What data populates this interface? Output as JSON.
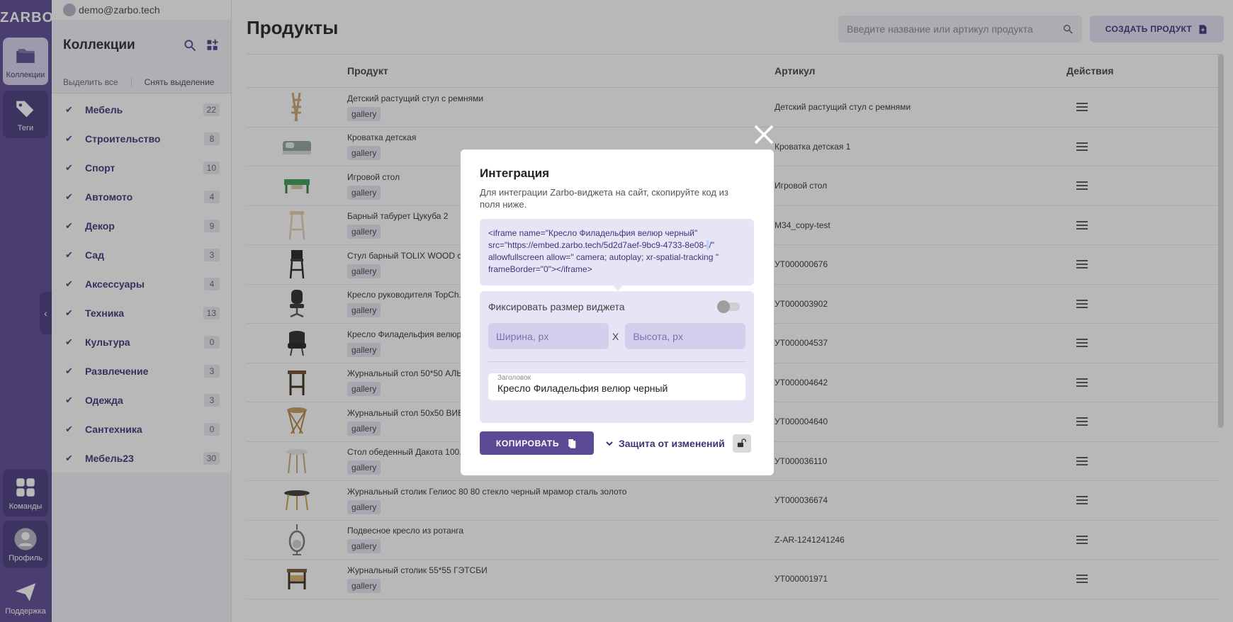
{
  "app": {
    "logo": "ZARBO",
    "user_email": "demo@zarbo.tech"
  },
  "rail": {
    "items": [
      {
        "label": "Коллекции",
        "icon": "folder-icon"
      },
      {
        "label": "Теги",
        "icon": "tags-icon"
      },
      {
        "label": "Команды",
        "icon": "grid-icon"
      },
      {
        "label": "Профиль",
        "icon": "user-icon"
      },
      {
        "label": "Поддержка",
        "icon": "send-icon"
      }
    ]
  },
  "collections": {
    "title": "Коллекции",
    "select_all": "Выделить все",
    "deselect_all": "Снять выделение",
    "items": [
      {
        "name": "Мебель",
        "count": "22"
      },
      {
        "name": "Строительство",
        "count": "8"
      },
      {
        "name": "Спорт",
        "count": "10"
      },
      {
        "name": "Автомото",
        "count": "4"
      },
      {
        "name": "Декор",
        "count": "9"
      },
      {
        "name": "Сад",
        "count": "3"
      },
      {
        "name": "Аксессуары",
        "count": "4"
      },
      {
        "name": "Техника",
        "count": "13"
      },
      {
        "name": "Культура",
        "count": "0"
      },
      {
        "name": "Развлечение",
        "count": "3"
      },
      {
        "name": "Одежда",
        "count": "3"
      },
      {
        "name": "Сантехника",
        "count": "0"
      },
      {
        "name": "Мебель23",
        "count": "30"
      }
    ]
  },
  "products": {
    "title": "Продукты",
    "search_placeholder": "Введите название или артикул продукта",
    "create_label": "СОЗДАТЬ ПРОДУКТ",
    "columns": {
      "product": "Продукт",
      "article": "Артикул",
      "actions": "Действия"
    },
    "rows": [
      {
        "name": "Детский растущий стул с ремнями",
        "tag": "gallery",
        "article": "Детский растущий стул с ремнями"
      },
      {
        "name": "Кроватка детская",
        "tag": "gallery",
        "article": "Кроватка детская 1"
      },
      {
        "name": "Игровой стол",
        "tag": "gallery",
        "article": "Игровой стол"
      },
      {
        "name": "Барный табурет Цукуба 2",
        "tag": "gallery",
        "article": "M34_copy-test"
      },
      {
        "name": "Стул барный TOLIX WOOD со...",
        "tag": "gallery",
        "article": "УТ000000676"
      },
      {
        "name": "Кресло руководителя TopCh...",
        "tag": "gallery",
        "article": "УТ000003902"
      },
      {
        "name": "Кресло Филадельфия велюр...",
        "tag": "gallery",
        "article": "УТ000004537"
      },
      {
        "name": "Журнальный стол 50*50 АЛЬ...",
        "tag": "gallery",
        "article": "УТ000004642"
      },
      {
        "name": "Журнальный стол 50x50 ВИВ...",
        "tag": "gallery",
        "article": "УТ000004640"
      },
      {
        "name": "Стол обеденный Дакота 100...",
        "tag": "gallery",
        "article": "УТ000036110"
      },
      {
        "name": "Журнальный столик Гелиос 80 80 стекло черный мрамор сталь золото",
        "tag": "gallery",
        "article": "УТ000036674"
      },
      {
        "name": "Подвесное кресло из ротанга",
        "tag": "gallery",
        "article": "Z-AR-1241241246"
      },
      {
        "name": "Журнальный столик 55*55 ГЭТСБИ",
        "tag": "gallery",
        "article": "УТ000001971"
      }
    ]
  },
  "modal": {
    "title": "Интеграция",
    "description": "Для интеграции Zarbo-виджета на сайт, скопируйте код из поля ниже.",
    "code_part1": "<iframe name=\"Кресло Филадельфия велюр черный\" src=\"https://embed.zarbo.tech/5d2d7aef-9bc9-4733-8e08-",
    "code_part2": "/\" allowfullscreen allow=\" camera; autoplay; xr-spatial-tracking \" frameBorder=\"0\"></iframe>",
    "fix_size_label": "Фиксировать размер виджета",
    "width_placeholder": "Ширина, px",
    "height_placeholder": "Высота, px",
    "size_separator": "X",
    "title_field_label": "Заголовок",
    "title_field_value": "Кресло Филадельфия велюр черный",
    "copy_label": "КОПИРОВАТЬ",
    "protect_label": "Защита от изменений"
  }
}
